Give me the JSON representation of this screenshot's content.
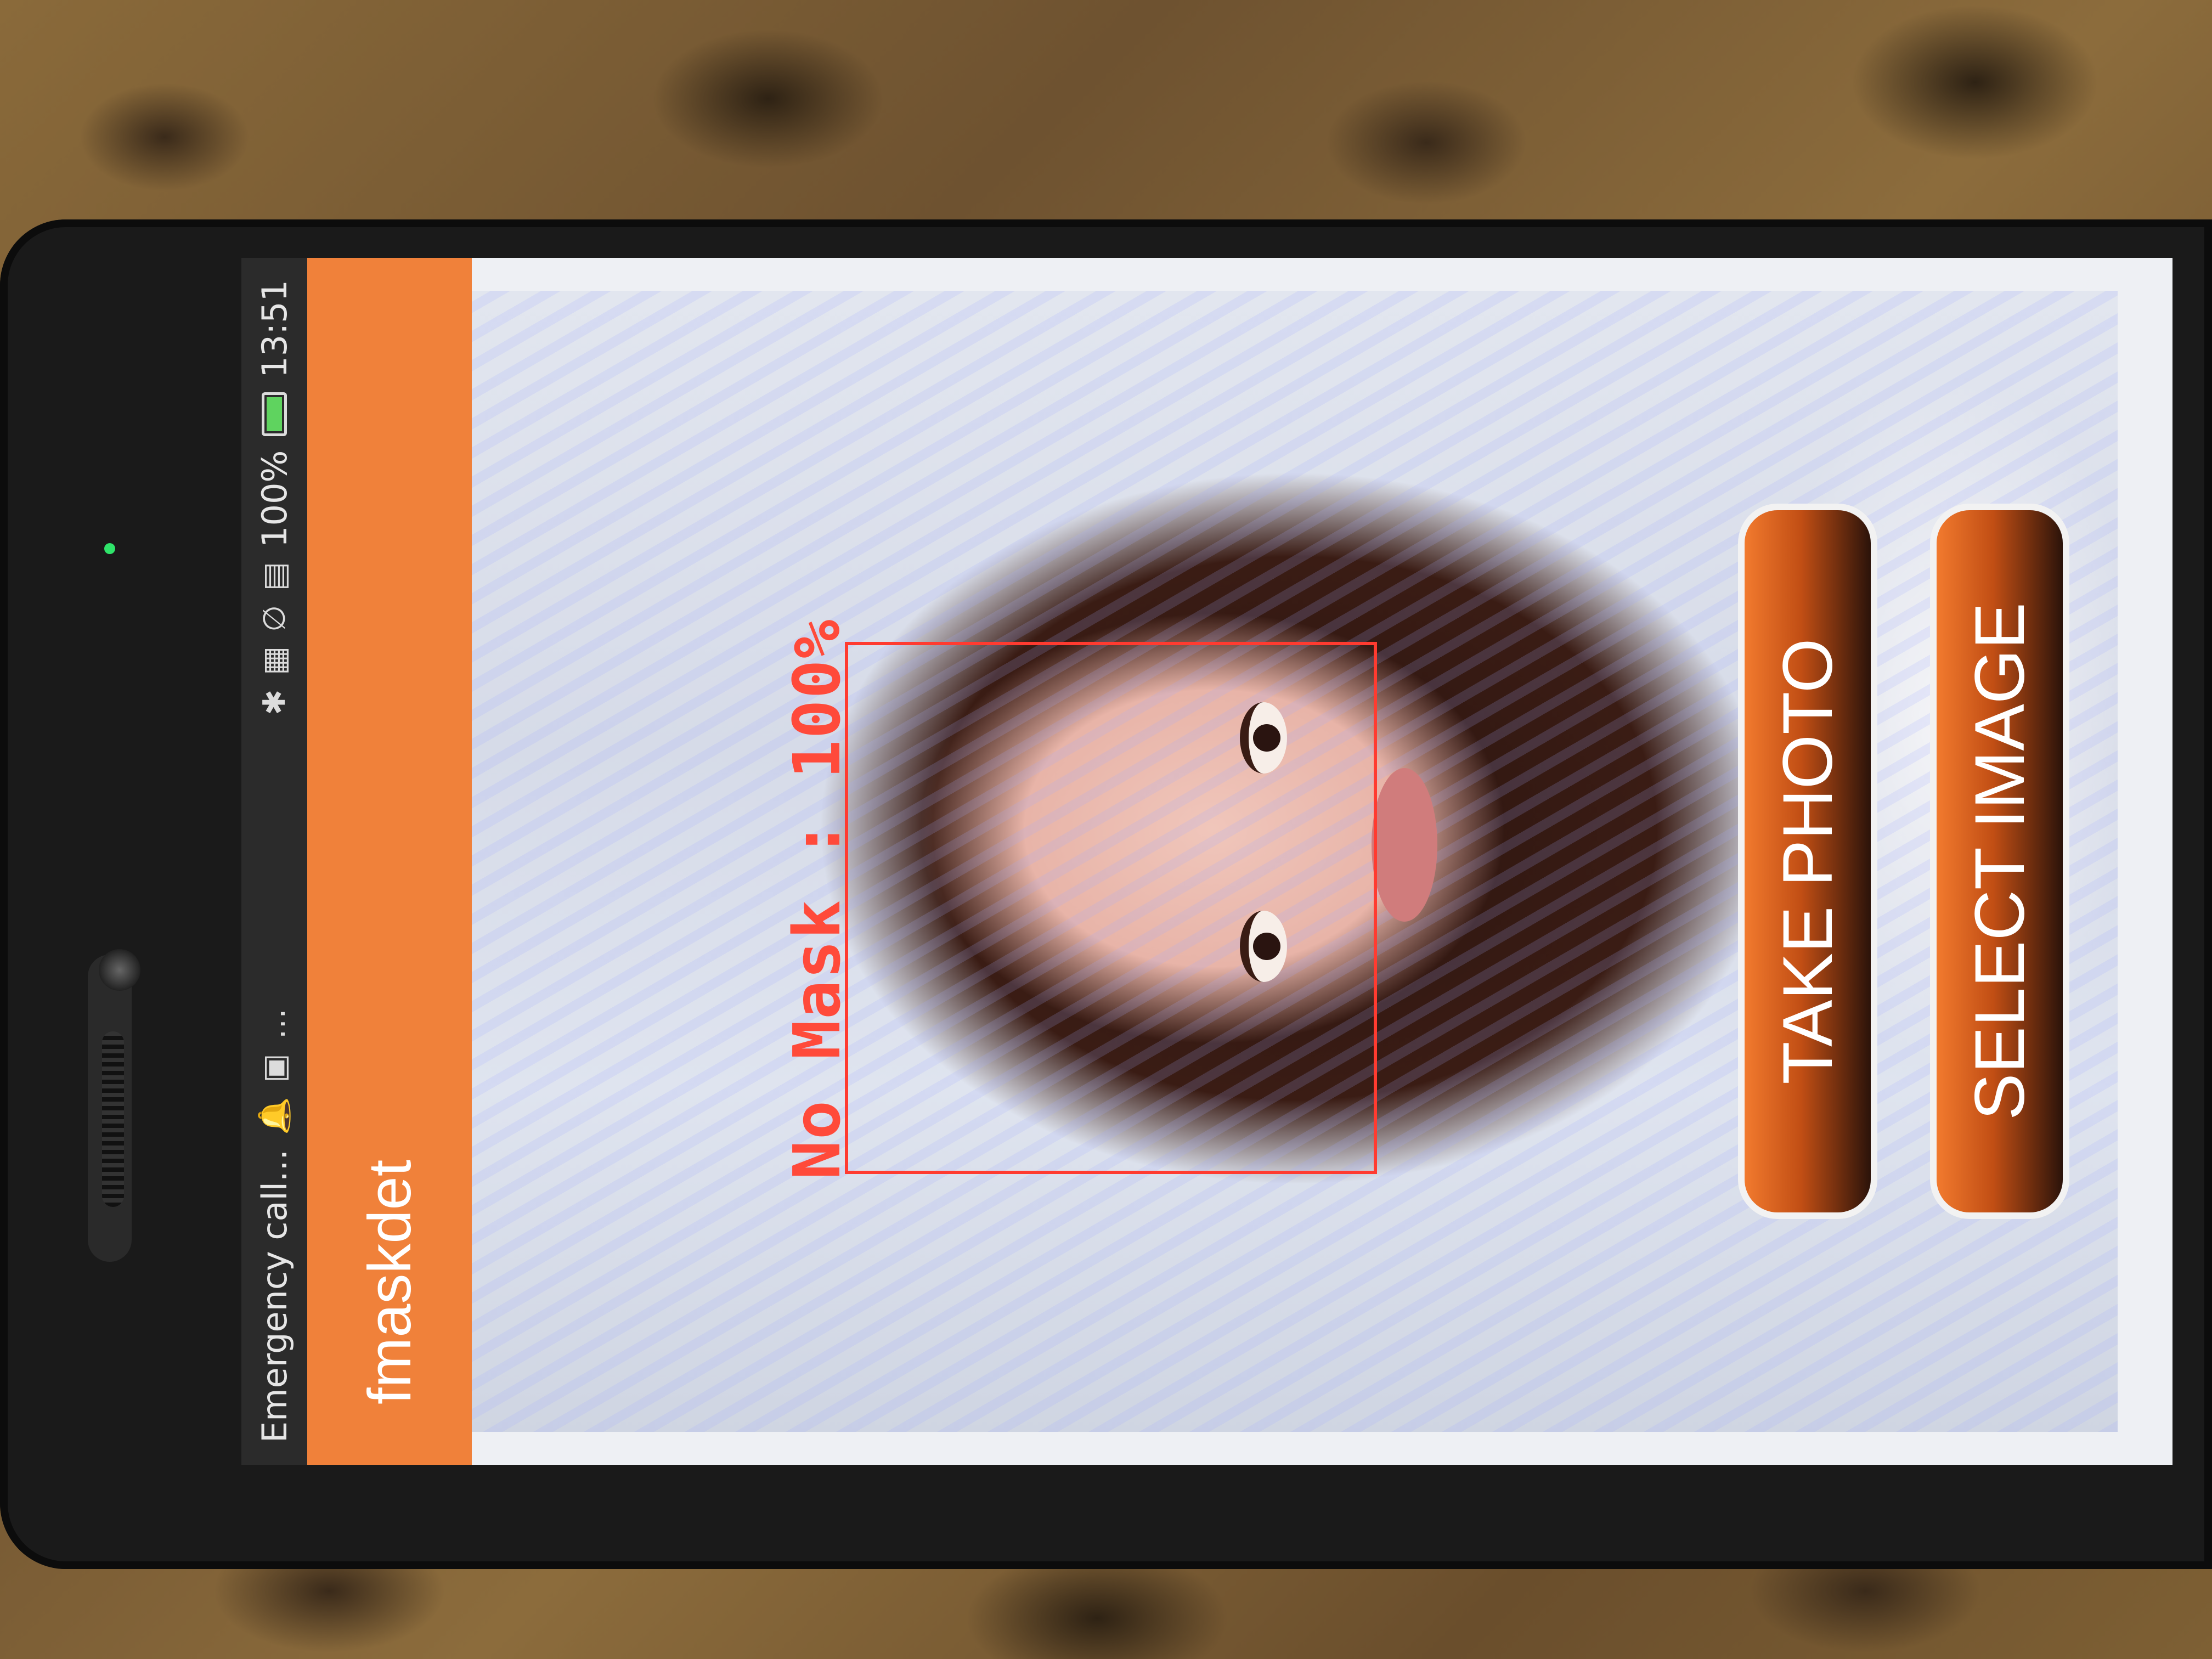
{
  "status_bar": {
    "left_text": "Emergency call...",
    "battery_percent": "100%",
    "time": "13:51",
    "icons": [
      "notification-icon",
      "more-icon",
      "bluetooth-icon",
      "nfc-icon",
      "mute-icon",
      "sim-icon",
      "battery-icon"
    ]
  },
  "app_bar": {
    "title": "fmaskdet"
  },
  "detection": {
    "label": "No Mask : 100%",
    "box_color": "#ff3b30"
  },
  "buttons": {
    "take_photo": "TAKE PHOTO",
    "select_image": "SELECT IMAGE"
  },
  "colors": {
    "accent": "#f0813a"
  }
}
